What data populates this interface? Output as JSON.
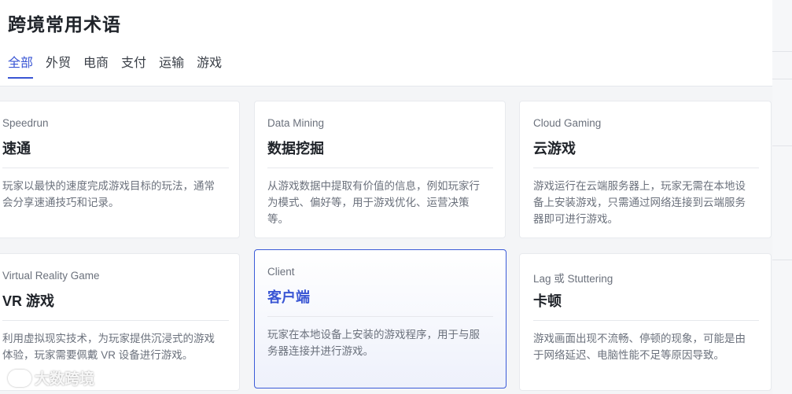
{
  "header": {
    "title": "跨境常用术语",
    "tabs": [
      {
        "label": "全部",
        "active": true
      },
      {
        "label": "外贸",
        "active": false
      },
      {
        "label": "电商",
        "active": false
      },
      {
        "label": "支付",
        "active": false
      },
      {
        "label": "运输",
        "active": false
      },
      {
        "label": "游戏",
        "active": false
      }
    ]
  },
  "cards": [
    {
      "en": "Speedrun",
      "zh": "速通",
      "desc": [
        "玩家以最快的速度完成游戏目标的玩法，通常",
        "会分享速通技巧和记录。"
      ],
      "selected": false
    },
    {
      "en": "Data Mining",
      "zh": "数据挖掘",
      "desc": [
        "从游戏数据中提取有价值的信息，例如玩家行",
        "为模式、偏好等，用于游戏优化、运营决策",
        "等。"
      ],
      "selected": false
    },
    {
      "en": "Cloud Gaming",
      "zh": "云游戏",
      "desc": [
        "游戏运行在云端服务器上，玩家无需在本地设",
        "备上安装游戏，只需通过网络连接到云端服务",
        "器即可进行游戏。"
      ],
      "selected": false
    },
    {
      "en": "Virtual Reality Game",
      "zh": "VR 游戏",
      "desc": [
        "利用虚拟现实技术，为玩家提供沉浸式的游戏",
        "体验，玩家需要佩戴 VR 设备进行游戏。"
      ],
      "selected": false
    },
    {
      "en": "Client",
      "zh": "客户端",
      "desc": [
        "玩家在本地设备上安装的游戏程序，用于与服",
        "务器连接并进行游戏。"
      ],
      "selected": true
    },
    {
      "en": "Lag 或 Stuttering",
      "zh": "卡顿",
      "desc": [
        "游戏画面出现不流畅、停顿的现象，可能是由",
        "于网络延迟、电脑性能不足等原因导致。"
      ],
      "selected": false
    }
  ],
  "watermark": {
    "text": "大数跨境"
  },
  "colors": {
    "accent": "#3a56d4",
    "selected_border": "#3b5bd8"
  }
}
